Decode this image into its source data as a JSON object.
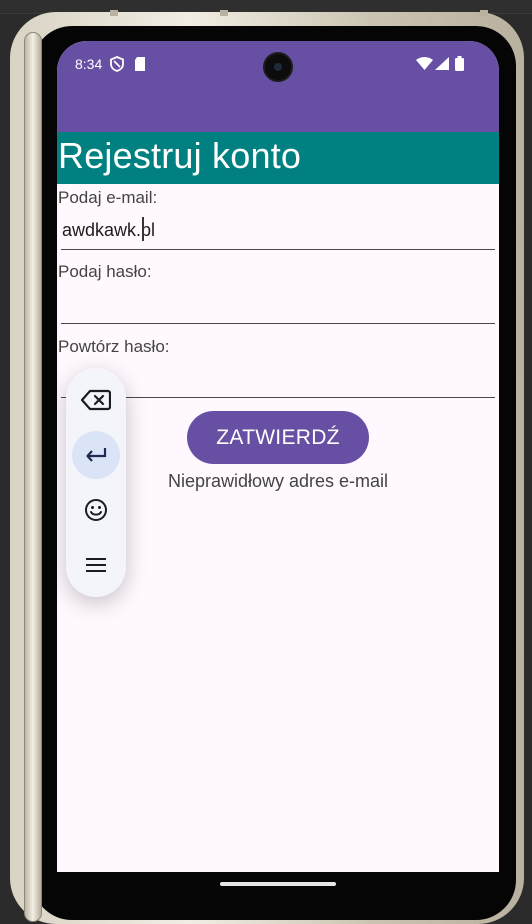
{
  "status_bar": {
    "time": "8:34",
    "icons": [
      "shield-icon",
      "sd-card-icon",
      "wifi-icon",
      "signal-icon",
      "battery-icon"
    ]
  },
  "app_bar": {
    "title": "Rejestruj konto"
  },
  "form": {
    "email_label": "Podaj e-mail:",
    "email_value": "awdkawk.pl",
    "password_label": "Podaj hasło:",
    "password_value": "",
    "repeat_password_label": "Powtórz hasło:",
    "repeat_password_value": "",
    "submit_label": "ZATWIERDŹ",
    "error_message": "Nieprawidłowy adres e-mail"
  },
  "floating_keyboard": {
    "buttons": [
      "backspace-icon",
      "enter-icon",
      "emoji-icon",
      "menu-icon"
    ]
  },
  "colors": {
    "status_bar": "#6750a4",
    "app_bar": "#008080",
    "button": "#6750a4",
    "background": "#fff8fe"
  }
}
